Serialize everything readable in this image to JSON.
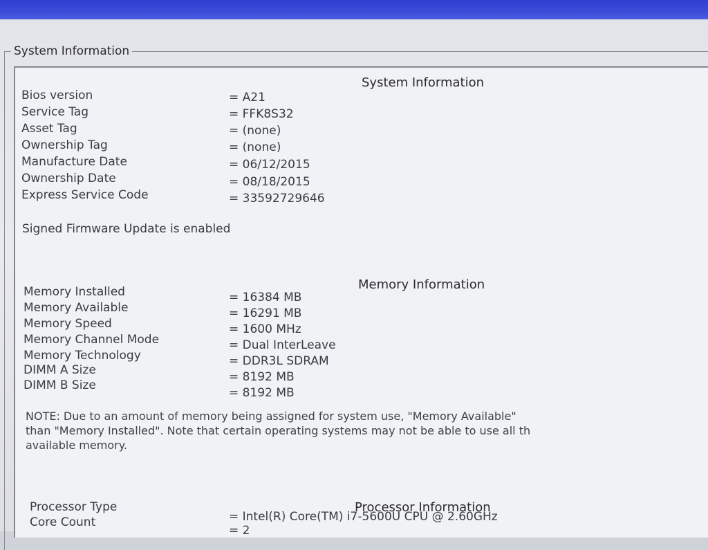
{
  "frame": {
    "legend": "System Information"
  },
  "system": {
    "title": "System Information",
    "rows": [
      {
        "label": "Bios version",
        "value": "= A21"
      },
      {
        "label": "Service Tag",
        "value": "= FFK8S32"
      },
      {
        "label": "Asset Tag",
        "value": "= (none)"
      },
      {
        "label": "Ownership Tag",
        "value": "= (none)"
      },
      {
        "label": "Manufacture Date",
        "value": "= 06/12/2015"
      },
      {
        "label": "Ownership Date",
        "value": "= 08/18/2015"
      },
      {
        "label": "Express Service Code",
        "value": "= 33592729646"
      }
    ],
    "firmware_status": "Signed Firmware Update is enabled"
  },
  "memory": {
    "title": "Memory Information",
    "rows": [
      {
        "label": "Memory Installed",
        "value": "= 16384 MB"
      },
      {
        "label": "Memory Available",
        "value": "= 16291 MB"
      },
      {
        "label": "Memory Speed",
        "value": "= 1600 MHz"
      },
      {
        "label": "Memory Channel Mode",
        "value": "= Dual InterLeave"
      },
      {
        "label": "Memory Technology",
        "value": "= DDR3L SDRAM"
      },
      {
        "label": "DIMM A Size",
        "value": "= 8192 MB"
      },
      {
        "label": "DIMM B Size",
        "value": "= 8192 MB"
      }
    ],
    "note_lines": [
      "NOTE: Due to an amount of memory being assigned for system use, \"Memory Available\"",
      "than \"Memory Installed\". Note that certain operating systems may not be able to use all th",
      "available memory."
    ]
  },
  "processor": {
    "title": "Processor Information",
    "rows": [
      {
        "label": "Processor Type",
        "value": "= Intel(R) Core(TM) i7-5600U CPU @ 2.60GHz"
      },
      {
        "label": "Core Count",
        "value": "= 2"
      }
    ]
  }
}
